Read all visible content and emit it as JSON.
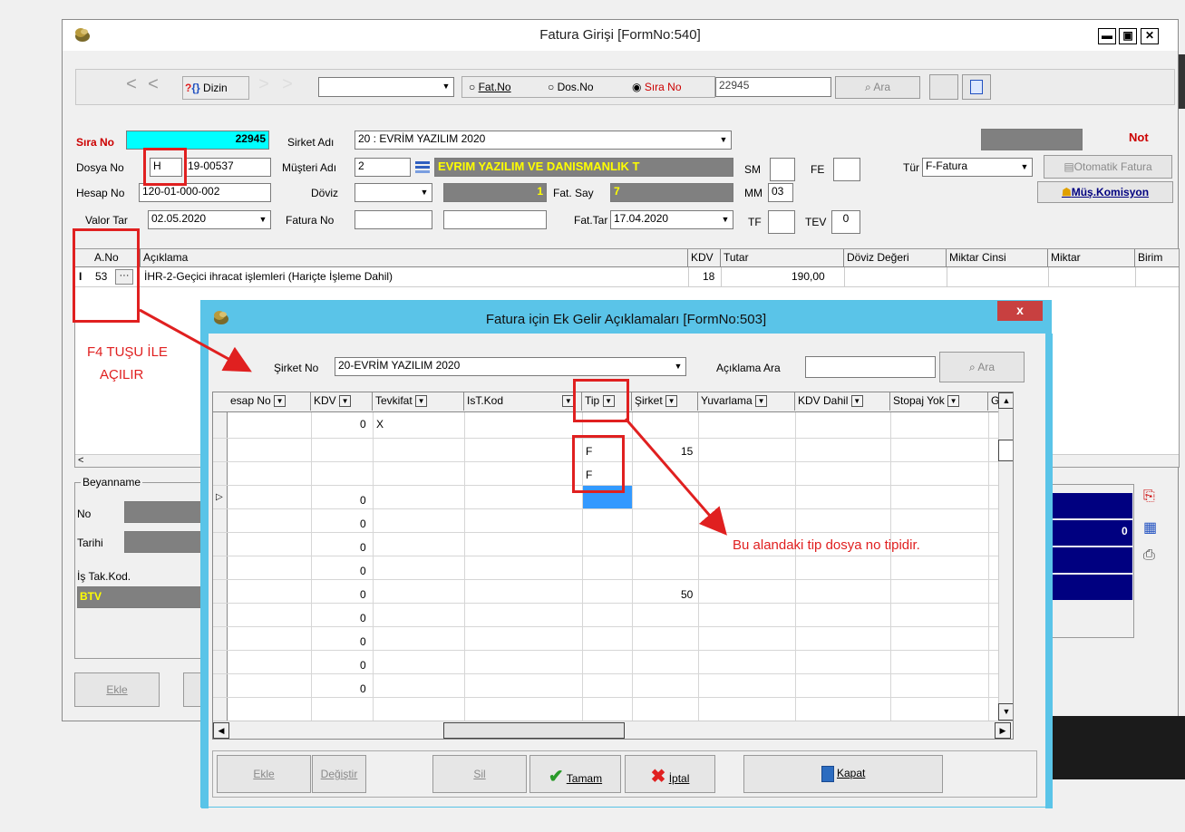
{
  "main_window": {
    "title": "Fatura Girişi [FormNo:540]",
    "toolbar": {
      "dizin_label": "Dizin",
      "help_label": "?{}",
      "radio_fatno": "Fat.No",
      "radio_dosno": "Dos.No",
      "radio_sirano": "Sıra No",
      "search_value": "22945",
      "ara_label": "Ara"
    },
    "form": {
      "sira_no_label": "Sıra No",
      "sira_no_value": "22945",
      "sirket_adi_label": "Sirket Adı",
      "sirket_adi_value": "20 : EVRİM YAZILIM  2020",
      "dosya_no_label": "Dosya No",
      "dosya_no_type": "H",
      "dosya_no_value": "19-00537",
      "musteri_adi_label": "Müşteri Adı",
      "musteri_adi_code": "2",
      "musteri_name": "EVRIM YAZILIM VE DANISMANLIK T",
      "hesap_no_label": "Hesap No",
      "hesap_no_value": "120-01-000-002",
      "doviz_label": "Döviz",
      "doviz_num": "1",
      "fat_say_label": "Fat. Say",
      "fat_say_value": "7",
      "valor_tar_label": "Valor Tar",
      "valor_tar_value": "02.05.2020",
      "fatura_no_label": "Fatura No",
      "fat_tar_label": "Fat.Tar",
      "fat_tar_value": "17.04.2020",
      "sm_label": "SM",
      "fe_label": "FE",
      "mm_label": "MM",
      "mm_value": "03",
      "tf_label": "TF",
      "tev_label": "TEV",
      "tev_value": "0",
      "tur_label": "Tür",
      "tur_value": "F-Fatura",
      "not_label": "Not",
      "otomatik_fatura": "Otomatik Fatura",
      "mus_komisyon": "Müş.Komisyon"
    },
    "grid": {
      "headers": [
        "A.No",
        "Açıklama",
        "KDV",
        "Tutar",
        "Döviz Değeri",
        "Miktar Cinsi",
        "Miktar",
        "Birim"
      ],
      "row": {
        "a_no": "53",
        "aciklama": "İHR-2-Geçici ihracat işlemleri (Hariçte İşleme Dahil)",
        "kdv": "18",
        "tutar": "190,00"
      }
    },
    "beyanname": {
      "legend": "Beyanname",
      "no_label": "No",
      "tarihi_label": "Tarihi",
      "is_tak_kod_label": "İş Tak.Kod.",
      "btv_label": "BTV"
    },
    "right_panel_value": "0",
    "ekle_label": "Ekle"
  },
  "annotations": {
    "f4_text_line1": "F4 TUŞU İLE",
    "f4_text_line2": "AÇILIR",
    "tip_note": "Bu alandaki tip dosya no tipidir."
  },
  "dialog": {
    "title": "Fatura için Ek Gelir Açıklamaları [FormNo:503]",
    "close_label": "x",
    "sirket_no_label": "Şirket No",
    "sirket_no_value": "20-EVRİM YAZILIM  2020",
    "aciklama_ara_label": "Açıklama Ara",
    "ara_label": "Ara",
    "columns": [
      "esap No",
      "KDV",
      "Tevkifat",
      "IsT.Kod",
      "Tip",
      "Şirket",
      "Yuvarlama",
      "KDV Dahil",
      "Stopaj Yok",
      "GL"
    ],
    "rows": [
      {
        "kdv": "0",
        "tevkifat": "X",
        "tip": "",
        "sirket": ""
      },
      {
        "kdv": "",
        "tevkifat": "",
        "tip": "F",
        "sirket": "15"
      },
      {
        "kdv": "",
        "tevkifat": "",
        "tip": "F",
        "sirket": ""
      },
      {
        "kdv": "0",
        "tevkifat": "",
        "tip": "",
        "sirket": ""
      },
      {
        "kdv": "0",
        "tevkifat": "",
        "tip": "",
        "sirket": ""
      },
      {
        "kdv": "0",
        "tevkifat": "",
        "tip": "",
        "sirket": ""
      },
      {
        "kdv": "0",
        "tevkifat": "",
        "tip": "",
        "sirket": ""
      },
      {
        "kdv": "0",
        "tevkifat": "",
        "tip": "",
        "sirket": "50"
      },
      {
        "kdv": "0",
        "tevkifat": "",
        "tip": "",
        "sirket": ""
      },
      {
        "kdv": "0",
        "tevkifat": "",
        "tip": "",
        "sirket": ""
      },
      {
        "kdv": "0",
        "tevkifat": "",
        "tip": "",
        "sirket": ""
      },
      {
        "kdv": "0",
        "tevkifat": "",
        "tip": "",
        "sirket": ""
      }
    ],
    "buttons": {
      "ekle": "Ekle",
      "degistir": "Değiştir",
      "sil": "Sil",
      "tamam": "Tamam",
      "iptal": "İptal",
      "kapat": "Kapat"
    }
  },
  "colors": {
    "accent_cyan": "#00ffff",
    "navy": "#000080",
    "highlight_red": "#e02020",
    "dialog_border": "#57c3e6"
  }
}
